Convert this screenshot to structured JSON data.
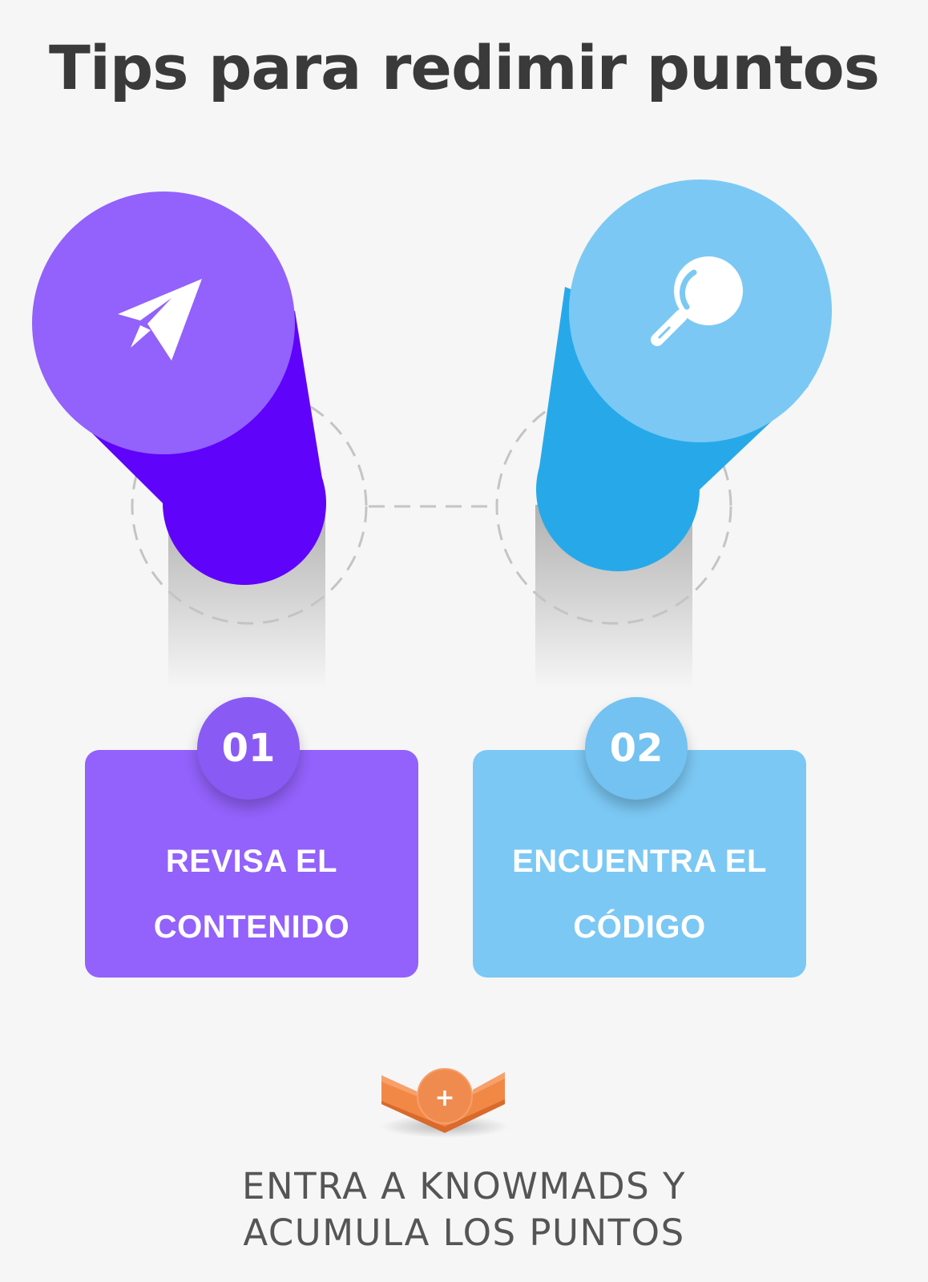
{
  "title": "Tips para redimir puntos",
  "steps": [
    {
      "number": "01",
      "line1": "REVISA EL",
      "line2": "CONTENIDO",
      "icon": "paper-plane-icon",
      "color_top": "#9361fb",
      "color_body": "#5f03fb"
    },
    {
      "number": "02",
      "line1": "ENCUENTRA EL",
      "line2": "CÓDIGO",
      "icon": "magnifier-icon",
      "color_top": "#7bc8f4",
      "color_body": "#27a9e9"
    }
  ],
  "plus_badge": {
    "symbol": "+",
    "color": "#f08b4f"
  },
  "footer": {
    "line1": "ENTRA A KNOWMADS Y",
    "line2": "ACUMULA LOS PUNTOS"
  }
}
